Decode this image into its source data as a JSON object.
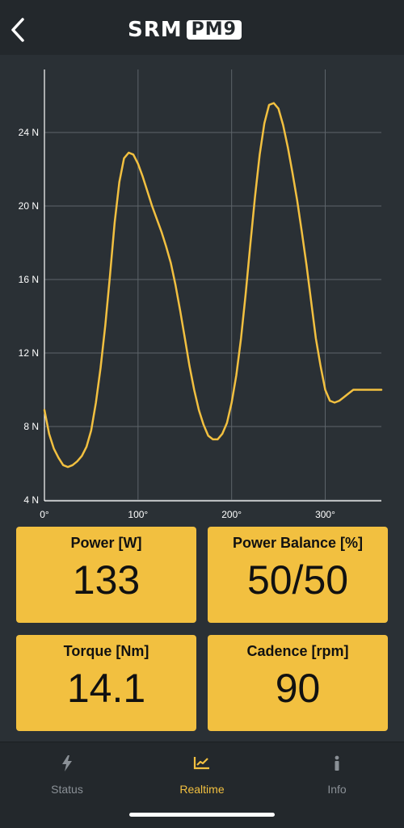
{
  "header": {
    "back_icon": "chevron-left-icon",
    "logo_brand": "SRM",
    "logo_model": "PM9"
  },
  "chart_data": {
    "type": "line",
    "x_ticks": [
      "0°",
      "100°",
      "200°",
      "300°"
    ],
    "y_ticks": [
      "4 N",
      "8 N",
      "12 N",
      "16 N",
      "20 N",
      "24 N"
    ],
    "xlim": [
      0,
      360
    ],
    "ylim": [
      4,
      26
    ],
    "grid": true,
    "line_color": "#f2c040",
    "series": [
      {
        "x": [
          0,
          5,
          10,
          15,
          20,
          25,
          30,
          35,
          40,
          45,
          50,
          55,
          60,
          65,
          70,
          75,
          80,
          85,
          90,
          95,
          100,
          105,
          110,
          115,
          120,
          125,
          130,
          135,
          140,
          145,
          150,
          155,
          160,
          165,
          170,
          175,
          180,
          185,
          190,
          195,
          200,
          205,
          210,
          215,
          220,
          225,
          230,
          235,
          240,
          245,
          250,
          255,
          260,
          265,
          270,
          275,
          280,
          285,
          290,
          295,
          300,
          305,
          310,
          315,
          320,
          325,
          330,
          335,
          340,
          345,
          350,
          355,
          360
        ],
        "y": [
          8.9,
          7.6,
          6.8,
          6.3,
          5.9,
          5.8,
          5.9,
          6.1,
          6.4,
          6.9,
          7.8,
          9.3,
          11.2,
          13.5,
          16.2,
          19.1,
          21.3,
          22.6,
          22.9,
          22.8,
          22.3,
          21.6,
          20.8,
          20.0,
          19.3,
          18.6,
          17.8,
          16.9,
          15.7,
          14.3,
          12.8,
          11.3,
          10.0,
          8.9,
          8.1,
          7.5,
          7.3,
          7.3,
          7.6,
          8.2,
          9.3,
          10.8,
          12.8,
          15.2,
          17.9,
          20.5,
          22.8,
          24.5,
          25.5,
          25.6,
          25.3,
          24.4,
          23.2,
          21.8,
          20.3,
          18.6,
          16.8,
          14.8,
          12.8,
          11.3,
          10.0,
          9.4,
          9.3,
          9.4,
          9.6,
          9.8,
          10.0,
          10.0,
          10.0,
          10.0,
          10.0,
          10.0,
          10.0
        ]
      }
    ]
  },
  "cards": [
    {
      "label": "Power [W]",
      "value": "133"
    },
    {
      "label": "Power Balance [%]",
      "value": "50/50"
    },
    {
      "label": "Torque [Nm]",
      "value": "14.1"
    },
    {
      "label": "Cadence [rpm]",
      "value": "90"
    }
  ],
  "tabs": [
    {
      "label": "Status",
      "icon": "lightning-icon"
    },
    {
      "label": "Realtime",
      "icon": "line-chart-icon"
    },
    {
      "label": "Info",
      "icon": "info-icon"
    }
  ],
  "colors": {
    "accent": "#f2c040",
    "background": "#2a3035",
    "header": "#23282c",
    "inactive_tab": "#8a9096"
  }
}
